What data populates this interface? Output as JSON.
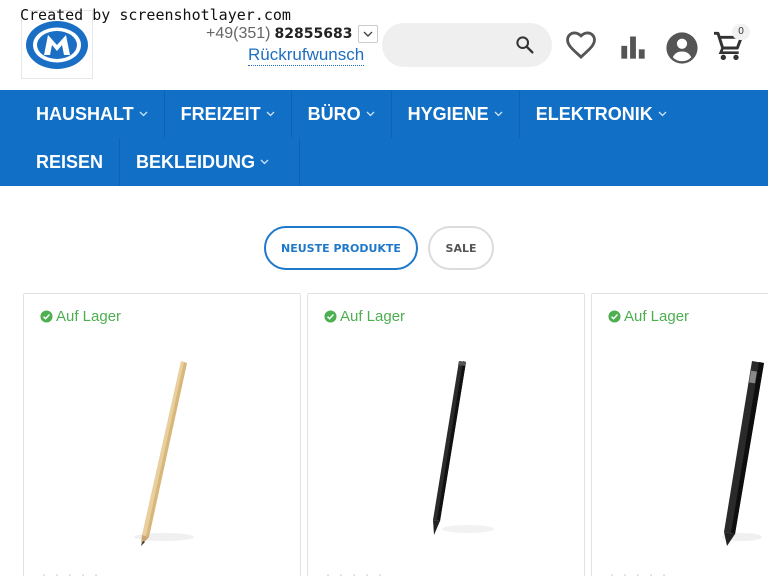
{
  "watermark": "Created by screenshotlayer.com",
  "header": {
    "phone_prefix": "+49(351)",
    "phone_number": "82855683",
    "callback_label": "Rückrufwunsch",
    "search_placeholder": "",
    "cart_count": "0"
  },
  "nav": {
    "row1": [
      {
        "label": "HAUSHALT",
        "dropdown": true
      },
      {
        "label": "FREIZEIT",
        "dropdown": true
      },
      {
        "label": "BÜRO",
        "dropdown": true
      },
      {
        "label": "HYGIENE",
        "dropdown": true
      },
      {
        "label": "ELEKTRONIK",
        "dropdown": true
      }
    ],
    "row2": [
      {
        "label": "REISEN",
        "dropdown": false
      },
      {
        "label": "BEKLEIDUNG",
        "dropdown": true
      }
    ]
  },
  "tabs": {
    "active_label": "NEUSTE PRODUKTE",
    "sale_label": "SALE"
  },
  "products": [
    {
      "stock": "Auf Lager",
      "image": "wooden-pencil"
    },
    {
      "stock": "Auf Lager",
      "image": "black-pencil"
    },
    {
      "stock": "Auf Lager",
      "image": "black-pen"
    }
  ],
  "colors": {
    "nav_bg": "#1170c6",
    "accent": "#1f78c9",
    "stock_green": "#4caf50"
  }
}
